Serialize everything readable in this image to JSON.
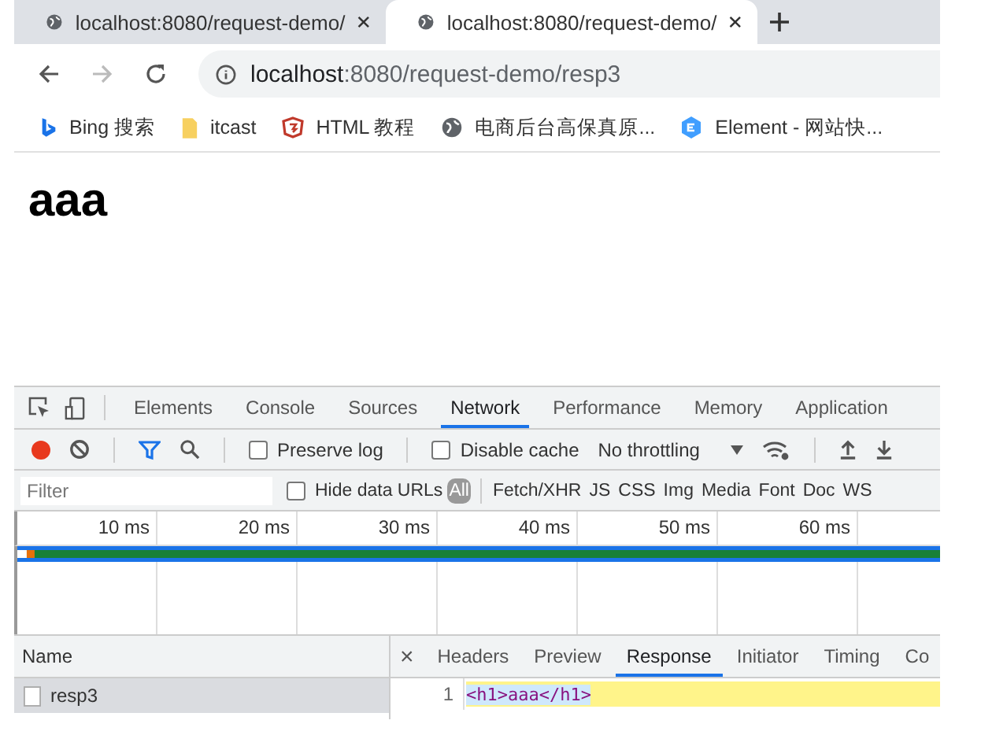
{
  "browser_tabs": [
    {
      "title": "localhost:8080/request-demo/",
      "selected": false
    },
    {
      "title": "localhost:8080/request-demo/",
      "selected": true
    }
  ],
  "address": {
    "host": "localhost",
    "rest": ":8080/request-demo/resp3"
  },
  "bookmarks": [
    {
      "kind": "bing",
      "label": "Bing 搜索"
    },
    {
      "kind": "folder",
      "label": "itcast"
    },
    {
      "kind": "html",
      "label": "HTML 教程"
    },
    {
      "kind": "globe",
      "label": "电商后台高保真原..."
    },
    {
      "kind": "element",
      "label": "Element - 网站快..."
    }
  ],
  "page": {
    "heading": "aaa"
  },
  "devtools": {
    "tabs": [
      {
        "label": "Elements",
        "selected": false
      },
      {
        "label": "Console",
        "selected": false
      },
      {
        "label": "Sources",
        "selected": false
      },
      {
        "label": "Network",
        "selected": true
      },
      {
        "label": "Performance",
        "selected": false
      },
      {
        "label": "Memory",
        "selected": false
      },
      {
        "label": "Application",
        "selected": false
      }
    ],
    "recording": true,
    "preserve_log": {
      "label": "Preserve log",
      "checked": false
    },
    "disable_cache": {
      "label": "Disable cache",
      "checked": false
    },
    "throttling": "No throttling",
    "filter": {
      "placeholder": "Filter"
    },
    "hide_data_urls": {
      "label": "Hide data URLs",
      "checked": false
    },
    "types": [
      {
        "label": "All",
        "selected": true
      },
      {
        "label": "Fetch/XHR",
        "selected": false
      },
      {
        "label": "JS",
        "selected": false
      },
      {
        "label": "CSS",
        "selected": false
      },
      {
        "label": "Img",
        "selected": false
      },
      {
        "label": "Media",
        "selected": false
      },
      {
        "label": "Font",
        "selected": false
      },
      {
        "label": "Doc",
        "selected": false
      },
      {
        "label": "WS",
        "selected": false
      }
    ],
    "ticks": [
      "10 ms",
      "20 ms",
      "30 ms",
      "40 ms",
      "50 ms",
      "60 ms"
    ],
    "name_header": "Name",
    "requests": [
      {
        "name": "resp3",
        "selected": true
      }
    ],
    "close": "×",
    "detail_tabs": [
      {
        "label": "Headers",
        "selected": false
      },
      {
        "label": "Preview",
        "selected": false
      },
      {
        "label": "Response",
        "selected": true
      },
      {
        "label": "Initiator",
        "selected": false
      },
      {
        "label": "Timing",
        "selected": false
      },
      {
        "label": "Co",
        "selected": false
      }
    ],
    "response_lines": [
      {
        "number": "1",
        "code": "<h1>aaa</h1>"
      }
    ]
  }
}
